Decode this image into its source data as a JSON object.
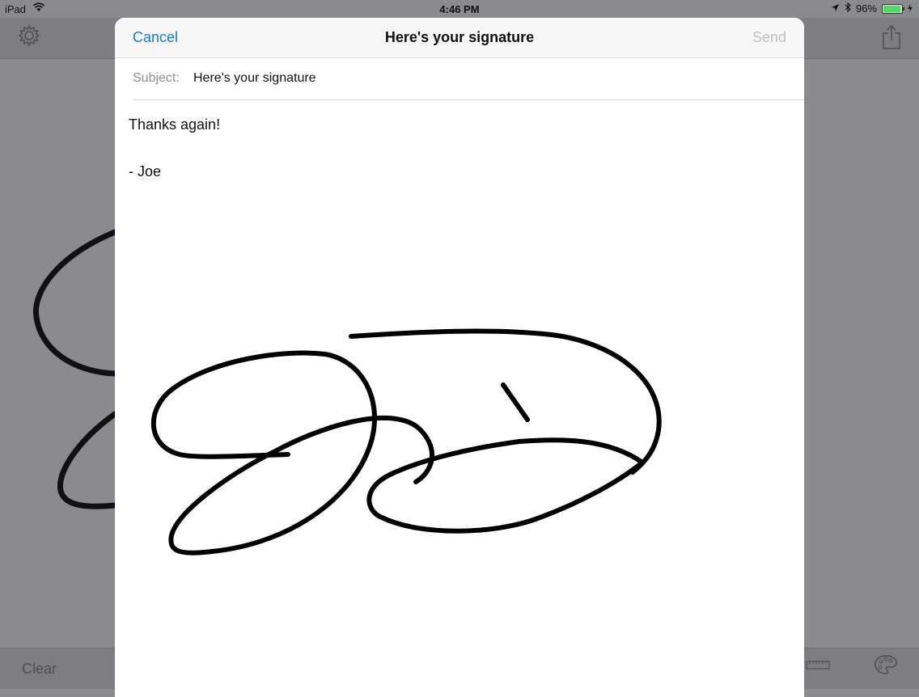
{
  "status_bar": {
    "device": "iPad",
    "time": "4:46 PM",
    "battery": "96%",
    "battery_level": 0.96
  },
  "background_app": {
    "toolbar": {
      "settings_icon": "gear-icon",
      "share_icon": "share-icon"
    },
    "bottom_bar": {
      "clear_label": "Clear",
      "ruler_icon": "ruler-icon",
      "palette_icon": "palette-icon"
    }
  },
  "compose_sheet": {
    "cancel_label": "Cancel",
    "title": "Here's your signature",
    "send_label": "Send",
    "subject_label": "Subject:",
    "subject_value": "Here's your signature",
    "body_lines": [
      "Thanks again!",
      "",
      "- Joe"
    ]
  },
  "colors": {
    "accent": "#1a7ad4",
    "disabled": "#c0c0c4",
    "overlay": "#8a8a8f"
  }
}
